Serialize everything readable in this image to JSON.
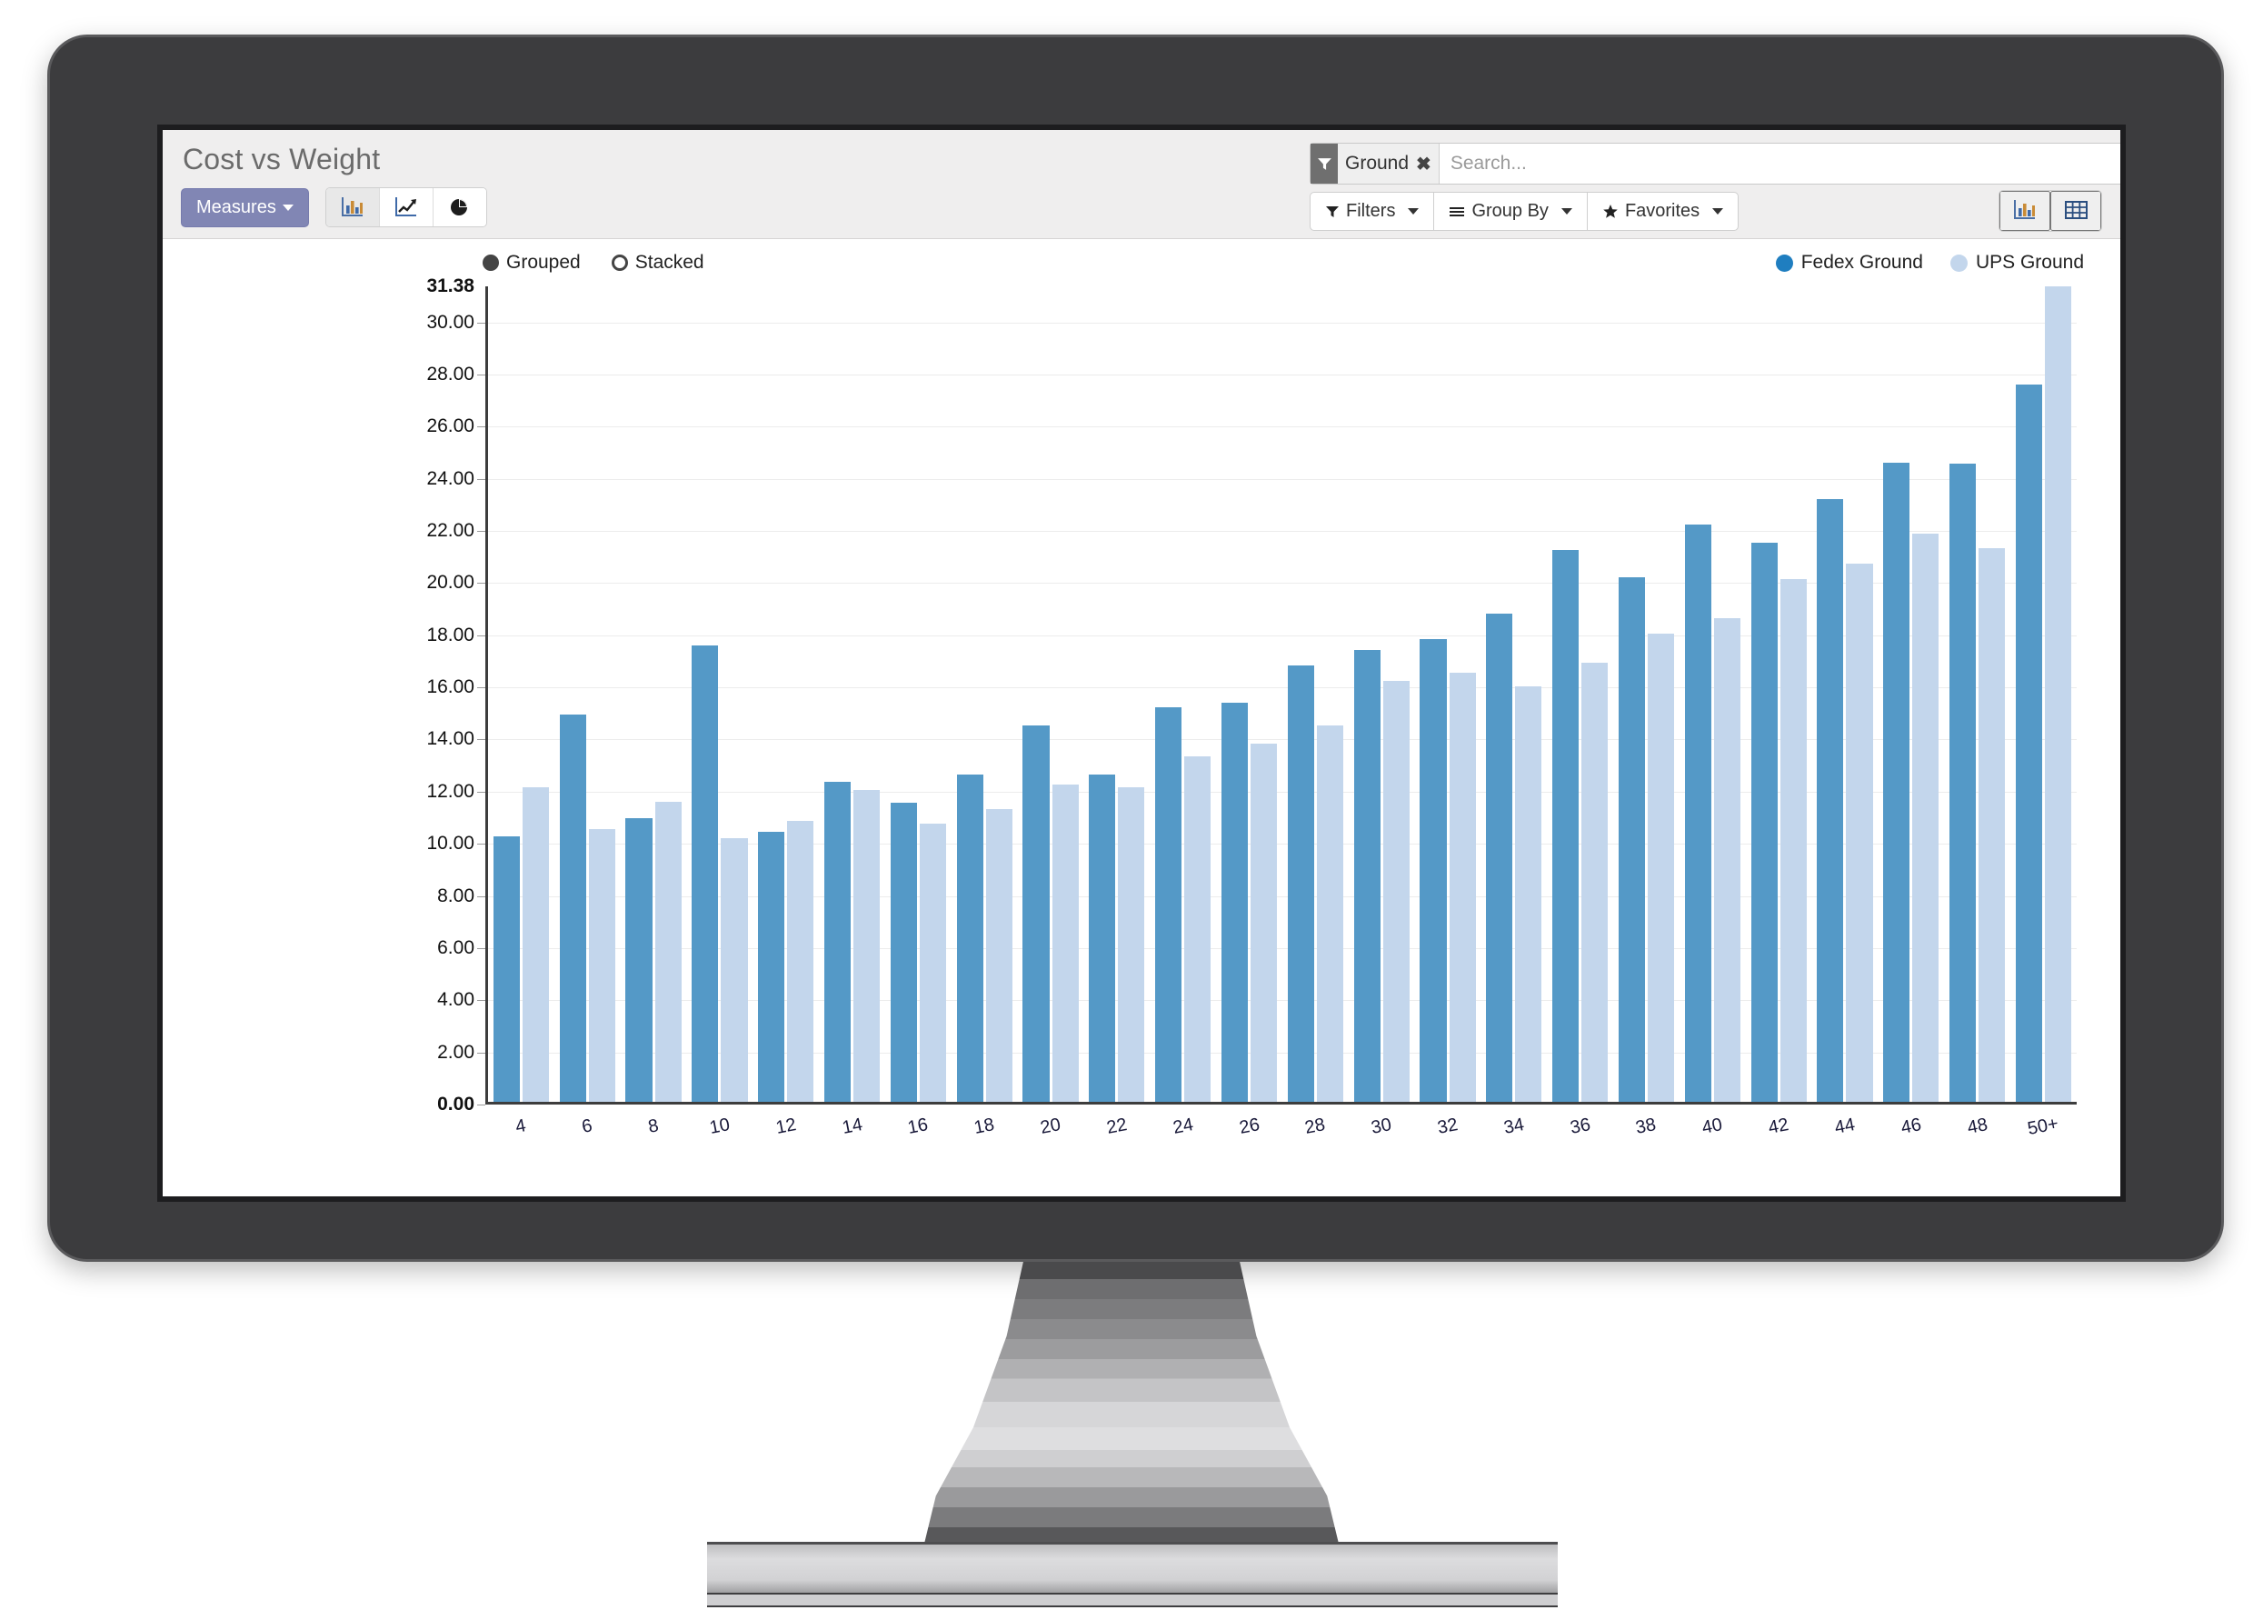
{
  "app": {
    "title": "Cost vs Weight",
    "measures_label": "Measures",
    "chart_type_buttons": [
      {
        "name": "bar-chart-icon",
        "label": "Bar Chart"
      },
      {
        "name": "line-chart-icon",
        "label": "Line Chart"
      },
      {
        "name": "pie-chart-icon",
        "label": "Pie Chart"
      }
    ]
  },
  "search": {
    "facet_label": "Ground",
    "facet_remove": "✖",
    "placeholder": "Search...",
    "value": ""
  },
  "toolbar": {
    "filters_label": "Filters",
    "group_by_label": "Group By",
    "favorites_label": "Favorites",
    "caret": "▾"
  },
  "view_toggle": {
    "graph_label": "Graph view",
    "list_label": "List view",
    "active": "graph"
  },
  "mode": {
    "grouped_label": "Grouped",
    "stacked_label": "Stacked",
    "selected": "Grouped"
  },
  "colors": {
    "series_1": "#5499c7",
    "series_2": "#c3d6ec",
    "measures_button": "#8186b4",
    "header_bg": "#efeeee",
    "bezel": "#3c3c3e"
  },
  "chart_data": {
    "type": "bar",
    "title": "Cost vs Weight",
    "xlabel": "",
    "ylabel": "",
    "ylim": [
      0,
      31.38
    ],
    "grid": true,
    "legend_position": "top-right",
    "orientation": "grouped",
    "ytick_labels": [
      "0.00",
      "2.00",
      "4.00",
      "6.00",
      "8.00",
      "10.00",
      "12.00",
      "14.00",
      "16.00",
      "18.00",
      "20.00",
      "22.00",
      "24.00",
      "26.00",
      "28.00",
      "30.00"
    ],
    "ytick_values": [
      0,
      2,
      4,
      6,
      8,
      10,
      12,
      14,
      16,
      18,
      20,
      22,
      24,
      26,
      28,
      30
    ],
    "ymax_label": "31.38",
    "categories": [
      "4",
      "6",
      "8",
      "10",
      "12",
      "14",
      "16",
      "18",
      "20",
      "22",
      "24",
      "26",
      "28",
      "30",
      "32",
      "34",
      "36",
      "38",
      "40",
      "42",
      "44",
      "46",
      "48",
      "50+"
    ],
    "series": [
      {
        "name": "Fedex Ground",
        "color": "#5499c7",
        "values": [
          10.2,
          14.9,
          10.9,
          17.55,
          10.4,
          12.3,
          11.5,
          12.6,
          14.5,
          12.6,
          15.2,
          15.35,
          16.8,
          17.4,
          17.8,
          18.8,
          21.25,
          20.2,
          22.2,
          21.5,
          23.2,
          24.6,
          24.55,
          27.6
        ]
      },
      {
        "name": "UPS Ground",
        "color": "#c3d6ec",
        "values": [
          12.1,
          10.5,
          11.55,
          10.15,
          10.8,
          12.0,
          10.7,
          11.25,
          12.2,
          12.1,
          13.3,
          13.8,
          14.5,
          16.2,
          16.5,
          16.0,
          16.9,
          18.0,
          18.6,
          20.1,
          20.7,
          21.85,
          21.3,
          31.38
        ]
      }
    ]
  }
}
